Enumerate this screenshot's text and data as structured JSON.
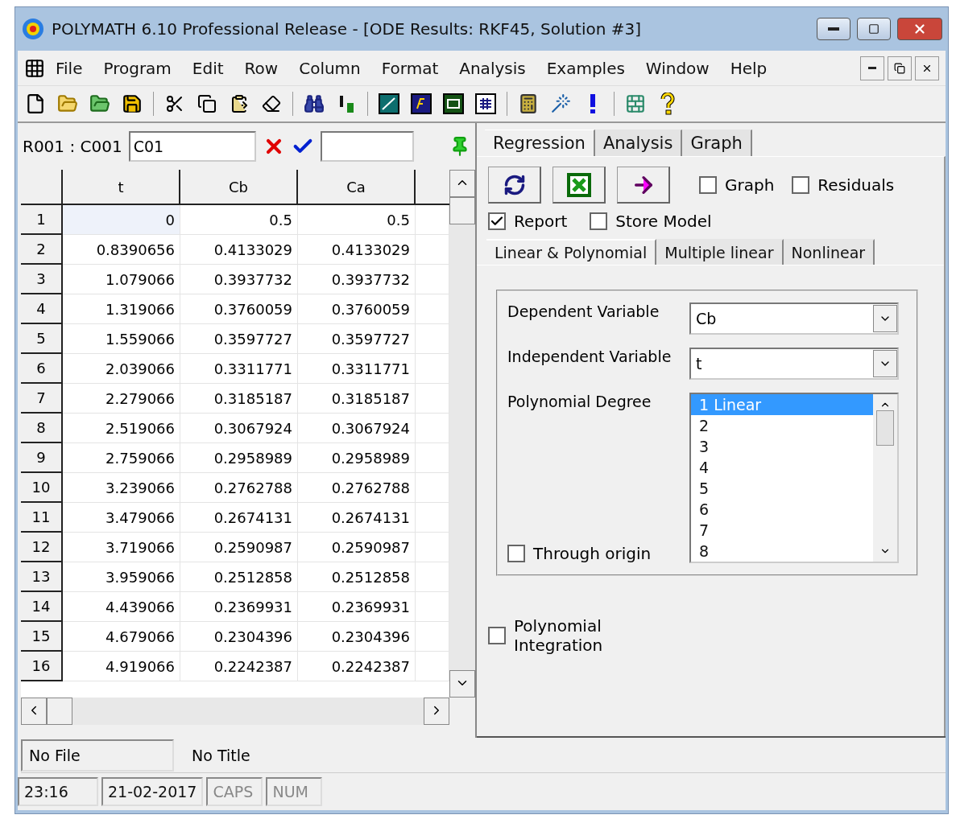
{
  "window": {
    "title": "POLYMATH 6.10 Professional Release - [ODE Results: RKF45, Solution #3]"
  },
  "menu": [
    "File",
    "Program",
    "Edit",
    "Row",
    "Column",
    "Format",
    "Analysis",
    "Examples",
    "Window",
    "Help"
  ],
  "cell_editor": {
    "reference": "R001 : C001",
    "value": "C01"
  },
  "table": {
    "columns": [
      "t",
      "Cb",
      "Ca"
    ],
    "rows": [
      {
        "number": "1",
        "cells": [
          "0",
          "0.5",
          "0.5"
        ],
        "selected": true
      },
      {
        "number": "2",
        "cells": [
          "0.8390656",
          "0.4133029",
          "0.4133029"
        ],
        "selected": false
      },
      {
        "number": "3",
        "cells": [
          "1.079066",
          "0.3937732",
          "0.3937732"
        ],
        "selected": false
      },
      {
        "number": "4",
        "cells": [
          "1.319066",
          "0.3760059",
          "0.3760059"
        ],
        "selected": false
      },
      {
        "number": "5",
        "cells": [
          "1.559066",
          "0.3597727",
          "0.3597727"
        ],
        "selected": false
      },
      {
        "number": "6",
        "cells": [
          "2.039066",
          "0.3311771",
          "0.3311771"
        ],
        "selected": false
      },
      {
        "number": "7",
        "cells": [
          "2.279066",
          "0.3185187",
          "0.3185187"
        ],
        "selected": false
      },
      {
        "number": "8",
        "cells": [
          "2.519066",
          "0.3067924",
          "0.3067924"
        ],
        "selected": false
      },
      {
        "number": "9",
        "cells": [
          "2.759066",
          "0.2958989",
          "0.2958989"
        ],
        "selected": false
      },
      {
        "number": "10",
        "cells": [
          "3.239066",
          "0.2762788",
          "0.2762788"
        ],
        "selected": false
      },
      {
        "number": "11",
        "cells": [
          "3.479066",
          "0.2674131",
          "0.2674131"
        ],
        "selected": false
      },
      {
        "number": "12",
        "cells": [
          "3.719066",
          "0.2590987",
          "0.2590987"
        ],
        "selected": false
      },
      {
        "number": "13",
        "cells": [
          "3.959066",
          "0.2512858",
          "0.2512858"
        ],
        "selected": false
      },
      {
        "number": "14",
        "cells": [
          "4.439066",
          "0.2369931",
          "0.2369931"
        ],
        "selected": false
      },
      {
        "number": "15",
        "cells": [
          "4.679066",
          "0.2304396",
          "0.2304396"
        ],
        "selected": false
      },
      {
        "number": "16",
        "cells": [
          "4.919066",
          "0.2242387",
          "0.2242387"
        ],
        "selected": false
      }
    ]
  },
  "tabs": [
    {
      "label": "Regression",
      "selected": true
    },
    {
      "label": "Analysis",
      "selected": false
    },
    {
      "label": "Graph",
      "selected": false
    }
  ],
  "options_top": [
    {
      "label": "Graph",
      "checked": false
    },
    {
      "label": "Residuals",
      "checked": false
    }
  ],
  "options_mid": [
    {
      "label": "Report",
      "checked": true
    },
    {
      "label": "Store Model",
      "checked": false
    }
  ],
  "subtabs": [
    {
      "label": "Linear & Polynomial",
      "selected": true
    },
    {
      "label": "Multiple linear",
      "selected": false
    },
    {
      "label": "Nonlinear",
      "selected": false
    }
  ],
  "dependent_variable": {
    "label": "Dependent Variable",
    "value": "Cb"
  },
  "independent_variable": {
    "label": "Independent Variable",
    "value": "t"
  },
  "polynomial_degree": {
    "label": "Polynomial Degree",
    "items": [
      {
        "label": "1 Linear",
        "selected": true
      },
      {
        "label": "2",
        "selected": false
      },
      {
        "label": "3",
        "selected": false
      },
      {
        "label": "4",
        "selected": false
      },
      {
        "label": "5",
        "selected": false
      },
      {
        "label": "6",
        "selected": false
      },
      {
        "label": "7",
        "selected": false
      },
      {
        "label": "8",
        "selected": false
      }
    ]
  },
  "through_origin": {
    "label": "Through origin",
    "checked": false
  },
  "polynomial_integration": {
    "label": "Polynomial Integration",
    "checked": false
  },
  "file_bar": [
    "No File",
    "No Title"
  ],
  "status_bar": [
    {
      "text": "23:16",
      "disabled": false
    },
    {
      "text": "21-02-2017",
      "disabled": false
    },
    {
      "text": "CAPS",
      "disabled": true
    },
    {
      "text": "NUM",
      "disabled": true
    }
  ]
}
